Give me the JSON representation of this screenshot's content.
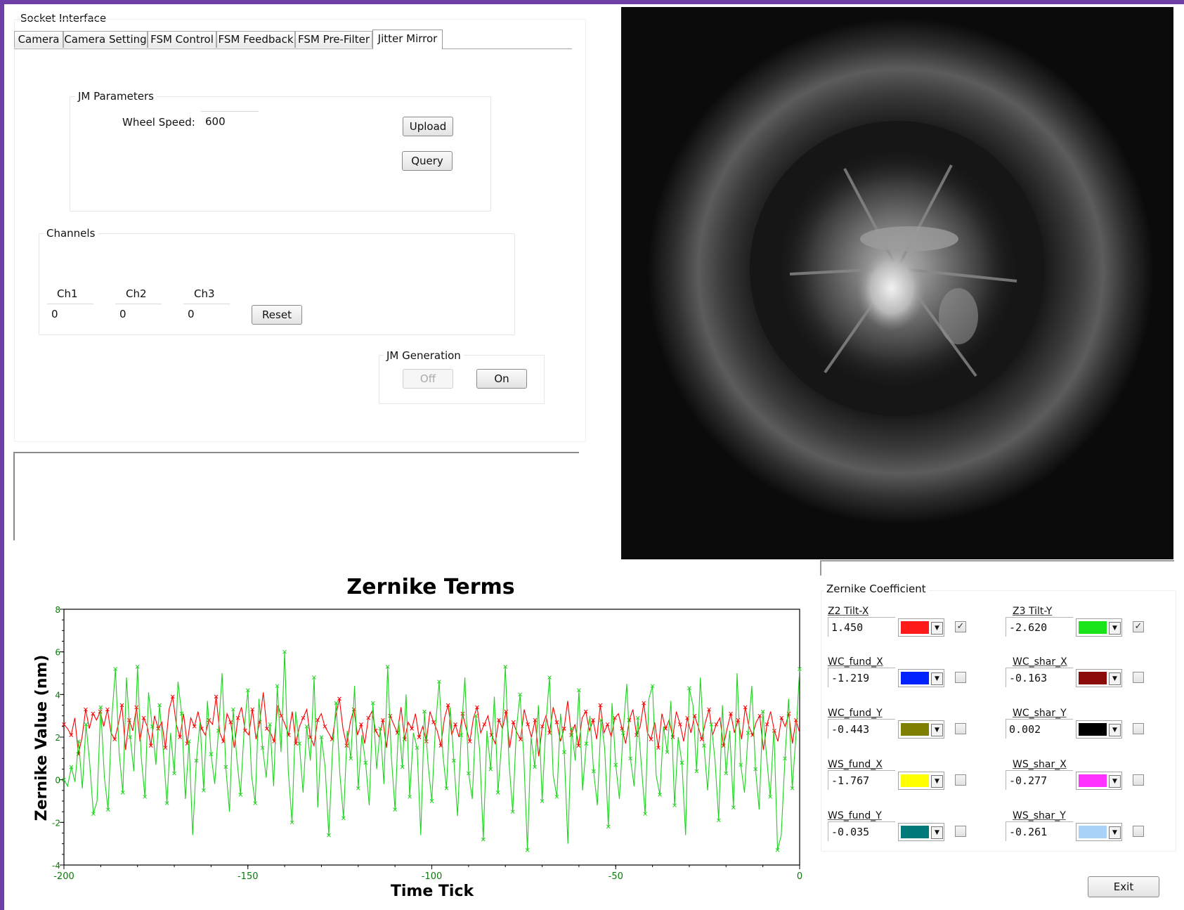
{
  "left_panel": {
    "socket_interface_title": "Socket Interface",
    "tabs": [
      {
        "label": "Camera"
      },
      {
        "label": "Camera Setting"
      },
      {
        "label": "FSM Control"
      },
      {
        "label": "FSM Feedback"
      },
      {
        "label": "FSM Pre-Filter"
      },
      {
        "label": "Jitter Mirror",
        "active": true
      }
    ],
    "jm_parameters": {
      "title": "JM Parameters",
      "wheel_speed_label": "Wheel Speed:",
      "wheel_speed_value": "600",
      "upload_label": "Upload",
      "query_label": "Query"
    },
    "channels": {
      "title": "Channels",
      "ch1_label": "Ch1",
      "ch1_value": "0",
      "ch2_label": "Ch2",
      "ch2_value": "0",
      "ch3_label": "Ch3",
      "ch3_value": "0",
      "reset_label": "Reset"
    },
    "jm_generation": {
      "title": "JM Generation",
      "off_label": "Off",
      "on_label": "On",
      "off_disabled": true
    }
  },
  "camera_view": {
    "icon": "wavefront-camera-image"
  },
  "chart_data": {
    "type": "line",
    "title": "Zernike Terms",
    "xlabel": "Time Tick",
    "ylabel": "Zernike Value (nm)",
    "xlim": [
      -200,
      0
    ],
    "ylim": [
      -4,
      8
    ],
    "x_ticks": [
      "-200",
      "-150",
      "-100",
      "-50",
      "0"
    ],
    "y_ticks": [
      "-4",
      "-2",
      "0",
      "2",
      "4",
      "6",
      "8"
    ],
    "grid": false,
    "series": [
      {
        "color": "#ff0000",
        "marker": "x",
        "count": 200,
        "values": [
          2.6,
          2.4,
          2.1,
          2.9,
          1.2,
          2.0,
          3.3,
          2.4,
          3.1,
          2.8,
          3.2,
          2.5,
          3.3,
          2.2,
          1.9,
          2.6,
          3.5,
          1.4,
          2.8,
          2.3,
          3.4,
          1.8,
          2.9,
          2.5,
          1.6,
          3.0,
          2.4,
          2.7,
          1.5,
          3.3,
          3.9,
          2.6,
          2.0,
          3.1,
          1.7,
          2.9,
          2.5,
          3.2,
          2.4,
          2.1,
          2.8,
          2.6,
          3.9,
          2.2,
          1.8,
          3.1,
          2.7,
          1.5,
          2.9,
          3.4,
          2.3,
          2.1,
          3.3,
          1.9,
          2.7,
          4.1,
          2.4,
          2.2,
          1.8,
          3.5,
          3.0,
          2.6,
          2.1,
          3.2,
          1.7,
          2.5,
          2.9,
          3.3,
          2.0,
          1.6,
          2.8,
          3.1,
          2.5,
          2.2,
          1.9,
          3.0,
          3.8,
          2.4,
          1.6,
          2.7,
          3.3,
          2.1,
          2.6,
          1.7,
          2.9,
          3.2,
          2.3,
          2.0,
          2.8,
          1.5,
          3.0,
          2.6,
          2.2,
          3.4,
          1.9,
          2.7,
          2.4,
          3.1,
          2.0,
          2.5,
          1.8,
          3.2,
          2.7,
          2.3,
          1.6,
          2.9,
          3.5,
          2.1,
          2.6,
          2.0,
          3.1,
          2.4,
          1.8,
          2.9,
          3.4,
          2.2,
          2.6,
          3.0,
          2.1,
          1.7,
          2.8,
          2.4,
          3.2,
          1.5,
          2.7,
          2.2,
          1.9,
          3.3,
          2.6,
          2.0,
          2.8,
          1.1,
          2.5,
          3.0,
          2.2,
          3.4,
          2.7,
          1.8,
          2.4,
          3.7,
          2.1,
          2.6,
          1.6,
          2.9,
          3.2,
          2.3,
          2.8,
          1.9,
          3.5,
          2.2,
          2.6,
          2.0,
          2.9,
          3.1,
          2.4,
          1.7,
          2.8,
          3.3,
          2.1,
          2.5,
          3.6,
          2.2,
          1.9,
          2.7,
          1.5,
          3.1,
          2.4,
          2.8,
          2.0,
          3.2,
          2.6,
          1.8,
          2.9,
          2.2,
          3.0,
          2.5,
          1.9,
          2.7,
          3.3,
          2.1,
          2.6,
          2.9,
          1.6,
          2.4,
          3.1,
          2.2,
          2.8,
          1.9,
          3.4,
          2.5,
          2.1,
          2.7,
          3.0,
          1.4,
          2.6,
          3.2,
          2.3,
          1.8,
          2.9,
          2.5,
          3.1,
          1.7,
          2.8,
          2.2
        ]
      },
      {
        "color": "#1fd21f",
        "marker": "x",
        "count": 200,
        "values": [
          0.0,
          -0.3,
          0.6,
          -0.1,
          1.8,
          -0.4,
          2.6,
          0.8,
          -1.6,
          -1.0,
          3.4,
          0.1,
          -1.4,
          2.9,
          5.2,
          1.3,
          -0.6,
          4.8,
          2.0,
          0.4,
          5.3,
          1.1,
          -0.8,
          4.1,
          2.5,
          0.7,
          3.5,
          1.4,
          -1.1,
          2.2,
          0.3,
          4.6,
          3.1,
          -0.9,
          1.8,
          -2.6,
          0.9,
          2.7,
          -0.5,
          3.7,
          1.2,
          -0.2,
          2.3,
          5.0,
          0.6,
          -1.5,
          3.3,
          1.0,
          -0.7,
          2.4,
          4.2,
          0.2,
          -1.1,
          3.8,
          1.5,
          0.1,
          2.6,
          -0.3,
          4.4,
          1.3,
          6.0,
          0.4,
          -2.0,
          3.2,
          1.7,
          -0.6,
          2.5,
          0.9,
          4.8,
          -1.3,
          2.0,
          0.6,
          -2.6,
          1.4,
          3.6,
          0.3,
          -1.8,
          2.3,
          1.0,
          4.4,
          -0.4,
          2.1,
          0.8,
          -1.2,
          3.6,
          0.5,
          2.4,
          -0.2,
          5.3,
          1.1,
          -1.4,
          2.8,
          0.6,
          4.0,
          -0.8,
          2.2,
          1.5,
          -2.6,
          3.2,
          0.7,
          -1.0,
          2.5,
          4.6,
          1.2,
          -0.4,
          3.4,
          0.9,
          -1.7,
          2.1,
          4.8,
          0.3,
          -0.9,
          3.0,
          1.4,
          -2.8,
          2.3,
          0.5,
          3.9,
          -0.6,
          1.8,
          5.3,
          0.8,
          -1.5,
          2.4,
          4.0,
          1.1,
          -3.3,
          2.0,
          0.6,
          3.5,
          -1.0,
          2.6,
          4.8,
          0.2,
          -0.8,
          3.1,
          1.3,
          -3.0,
          2.4,
          0.9,
          4.2,
          -0.5,
          1.7,
          3.0,
          0.4,
          -1.2,
          2.8,
          1.5,
          -2.2,
          3.6,
          0.7,
          -0.9,
          2.2,
          4.5,
          1.0,
          -0.3,
          2.9,
          0.6,
          -1.6,
          3.8,
          4.4,
          0.2,
          -0.7,
          2.5,
          1.3,
          3.7,
          -1.2,
          2.0,
          0.8,
          -2.6,
          4.3,
          3.5,
          0.4,
          4.8,
          1.6,
          -0.5,
          2.6,
          0.9,
          -1.9,
          3.5,
          0.3,
          2.3,
          -1.3,
          5.0,
          0.7,
          -0.6,
          2.2,
          4.4,
          0.5,
          -1.4,
          3.2,
          1.1,
          -0.8,
          2.4,
          -3.3,
          -2.6,
          1.0,
          3.8,
          -0.4,
          2.1,
          5.2
        ]
      }
    ]
  },
  "zernike_coefficient": {
    "title": "Zernike Coefficient",
    "items": [
      {
        "label": "Z2 Tilt-X",
        "value": "1.450",
        "color": "#ff1a1a",
        "checked": true
      },
      {
        "label": "Z3 Tilt-Y",
        "value": "-2.620",
        "color": "#19e319",
        "checked": true
      },
      {
        "label": "WC_fund_X",
        "value": "-1.219",
        "color": "#0022ff",
        "checked": false
      },
      {
        "label": "WC_shar_X",
        "value": "-0.163",
        "color": "#8b0a0a",
        "checked": false
      },
      {
        "label": "WC_fund_Y",
        "value": "-0.443",
        "color": "#808000",
        "checked": false
      },
      {
        "label": "WC_shar_Y",
        "value": "0.002",
        "color": "#000000",
        "checked": false
      },
      {
        "label": "WS_fund_X",
        "value": "-1.767",
        "color": "#ffff00",
        "checked": false
      },
      {
        "label": "WS_shar_X",
        "value": "-0.277",
        "color": "#ff33ff",
        "checked": false
      },
      {
        "label": "WS_fund_Y",
        "value": "-0.035",
        "color": "#007b7b",
        "checked": false
      },
      {
        "label": "WS_shar_Y",
        "value": "-0.261",
        "color": "#a8d2f8",
        "checked": false
      }
    ],
    "check_mark": "✓",
    "dropdown_icon": "chevron-down-icon"
  },
  "exit_label": "Exit"
}
